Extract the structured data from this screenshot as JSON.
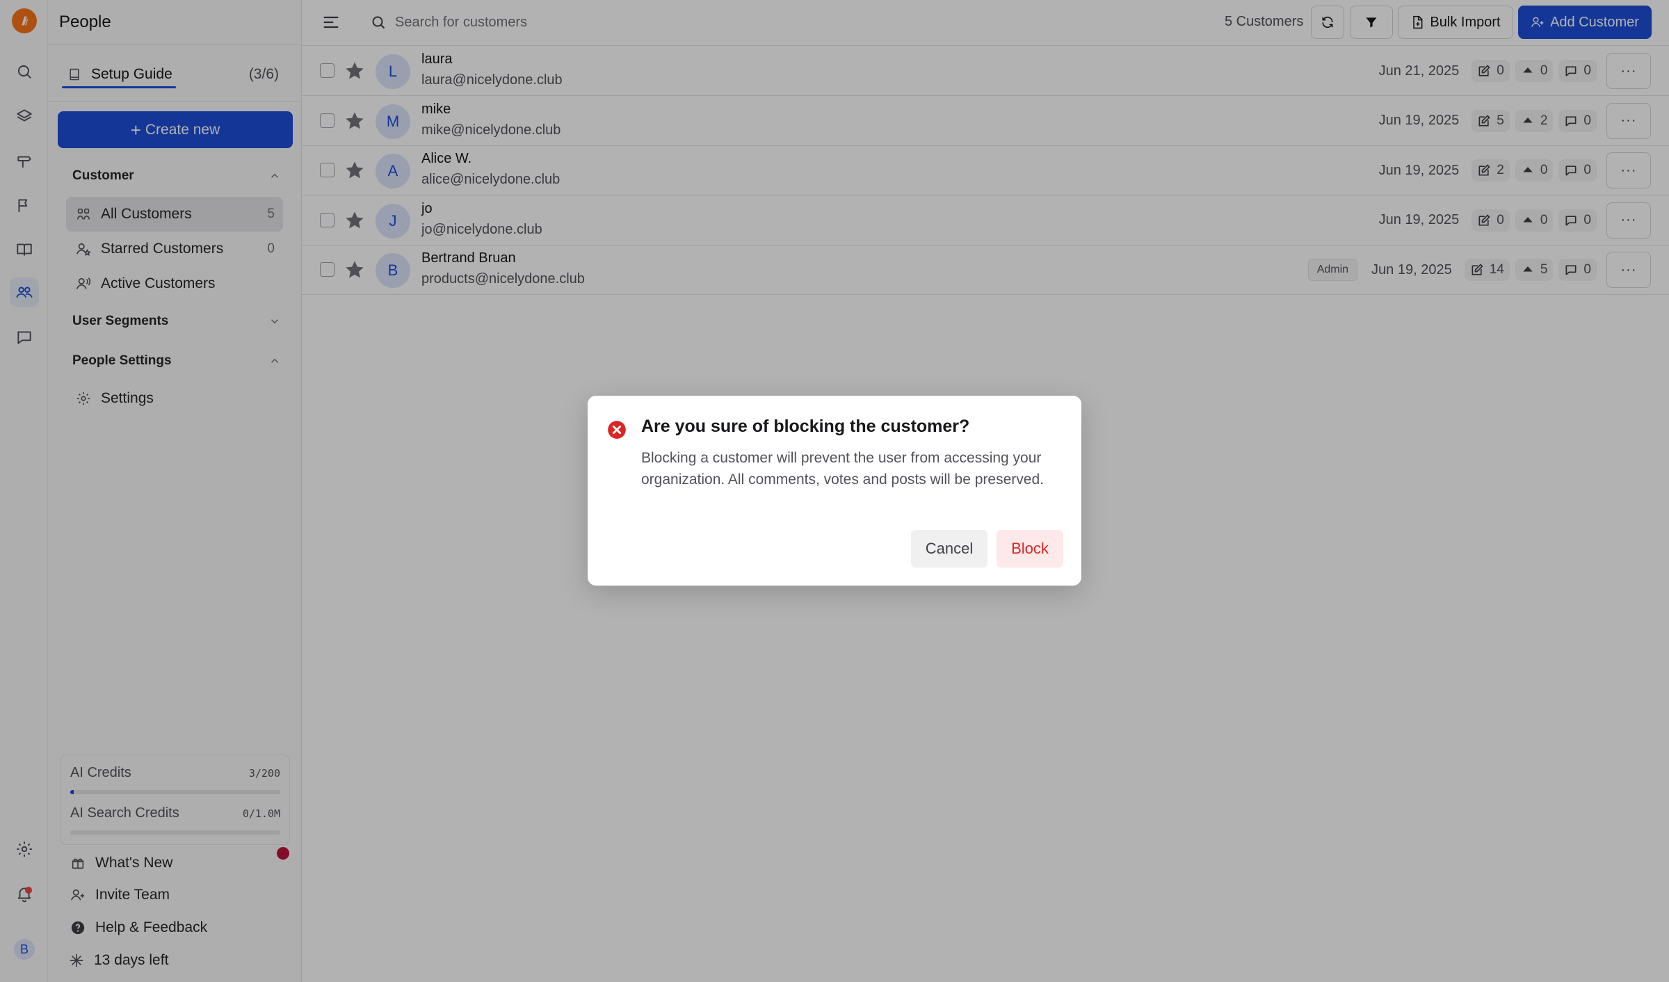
{
  "sidebar": {
    "title": "People",
    "setup_guide": {
      "label": "Setup Guide",
      "progress": "(3/6)"
    },
    "create_new": "Create new",
    "sections": {
      "customer": "Customer",
      "user_segments": "User Segments",
      "people_settings": "People Settings"
    },
    "customer_items": [
      {
        "label": "All Customers",
        "count": "5",
        "icon": "users-icon"
      },
      {
        "label": "Starred Customers",
        "count": "0",
        "icon": "user-star-icon"
      },
      {
        "label": "Active Customers",
        "count": "",
        "icon": "user-active-icon"
      }
    ],
    "settings_item": {
      "label": "Settings",
      "icon": "gear-icon"
    },
    "credits": {
      "ai_label": "AI Credits",
      "ai_value": "3/200",
      "ai_fraction": 0.015,
      "search_label": "AI Search Credits",
      "search_value": "0/1.0M",
      "search_fraction": 0
    },
    "footer": [
      {
        "label": "What's New",
        "icon": "gift-icon"
      },
      {
        "label": "Invite Team",
        "icon": "user-plus-icon"
      },
      {
        "label": "Help & Feedback",
        "icon": "help-icon"
      },
      {
        "label": "13 days left",
        "icon": "sparkle-icon"
      }
    ]
  },
  "rail": {
    "avatar_initial": "B",
    "icons": [
      "search-icon",
      "layers-icon",
      "signpost-icon",
      "flag-icon",
      "book-icon",
      "people-icon",
      "chat-icon",
      "gear-icon",
      "bell-icon"
    ]
  },
  "topbar": {
    "search_placeholder": "Search for customers",
    "count": "5 Customers",
    "bulk_import": "Bulk Import",
    "add_customer": "Add Customer"
  },
  "customers": [
    {
      "initial": "L",
      "name": "laura",
      "email": "laura@nicelydone.club",
      "badge": "",
      "date": "Jun 21, 2025",
      "posts": "0",
      "votes": "0",
      "comments": "0"
    },
    {
      "initial": "M",
      "name": "mike",
      "email": "mike@nicelydone.club",
      "badge": "",
      "date": "Jun 19, 2025",
      "posts": "5",
      "votes": "2",
      "comments": "0"
    },
    {
      "initial": "A",
      "name": "Alice W.",
      "email": "alice@nicelydone.club",
      "badge": "",
      "date": "Jun 19, 2025",
      "posts": "2",
      "votes": "0",
      "comments": "0"
    },
    {
      "initial": "J",
      "name": "jo",
      "email": "jo@nicelydone.club",
      "badge": "",
      "date": "Jun 19, 2025",
      "posts": "0",
      "votes": "0",
      "comments": "0"
    },
    {
      "initial": "B",
      "name": "Bertrand Bruan",
      "email": "products@nicelydone.club",
      "badge": "Admin",
      "date": "Jun 19, 2025",
      "posts": "14",
      "votes": "5",
      "comments": "0"
    }
  ],
  "dialog": {
    "title": "Are you sure of blocking the customer?",
    "body": "Blocking a customer will prevent the user from accessing your organization. All comments, votes and posts will be preserved.",
    "cancel": "Cancel",
    "confirm": "Block"
  },
  "colors": {
    "accent": "#1d4ed8",
    "danger": "#dc2626",
    "brand": "#f97316"
  }
}
